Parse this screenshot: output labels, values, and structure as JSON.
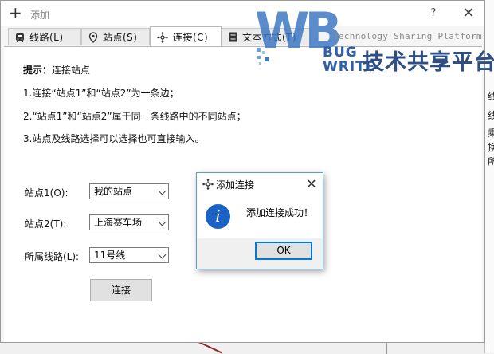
{
  "window": {
    "title": "添加",
    "help": "?",
    "close": "✕"
  },
  "tabs": [
    {
      "label": "线路(L)",
      "icon": "bus-icon"
    },
    {
      "label": "站点(S)",
      "icon": "location-pin-icon"
    },
    {
      "label": "连接(C)",
      "icon": "network-node-icon",
      "active": true
    },
    {
      "label": "文本方式(T)",
      "icon": "document-icon"
    }
  ],
  "hint": {
    "label": "提示：",
    "text": "连接站点"
  },
  "rules": [
    "1.连接“站点1”和“站点2”为一条边；",
    "2.“站点1”和“站点2”属于同一条线路中的不同站点；",
    "3.站点及线路选择可以选择也可直接输入。"
  ],
  "form": {
    "station1_label": "站点1(O):",
    "station1_value": "我的站点",
    "station2_label": "站点2(T):",
    "station2_value": "上海赛车场",
    "line_label": "所属线路(L):",
    "line_value": "11号线",
    "connect_button": "连接"
  },
  "dialog": {
    "title": "添加连接",
    "close": "✕",
    "icon": "info-icon",
    "icon_glyph": "i",
    "message": "添加连接成功！",
    "ok_button": "OK"
  },
  "watermark": {
    "logo_letters": "WB",
    "bug": "BUG",
    "write": "WRITE",
    "tagline": "Technology Sharing Platform",
    "chinese": "技术共享平台"
  },
  "background_fragments": [
    "线",
    "线",
    "乘",
    "换",
    "所"
  ],
  "colors": {
    "accent": "#0078d7",
    "info_blue": "#1a62c3",
    "dialog_border": "#5aa0c9",
    "watermark_blue": "#3f79c4"
  }
}
